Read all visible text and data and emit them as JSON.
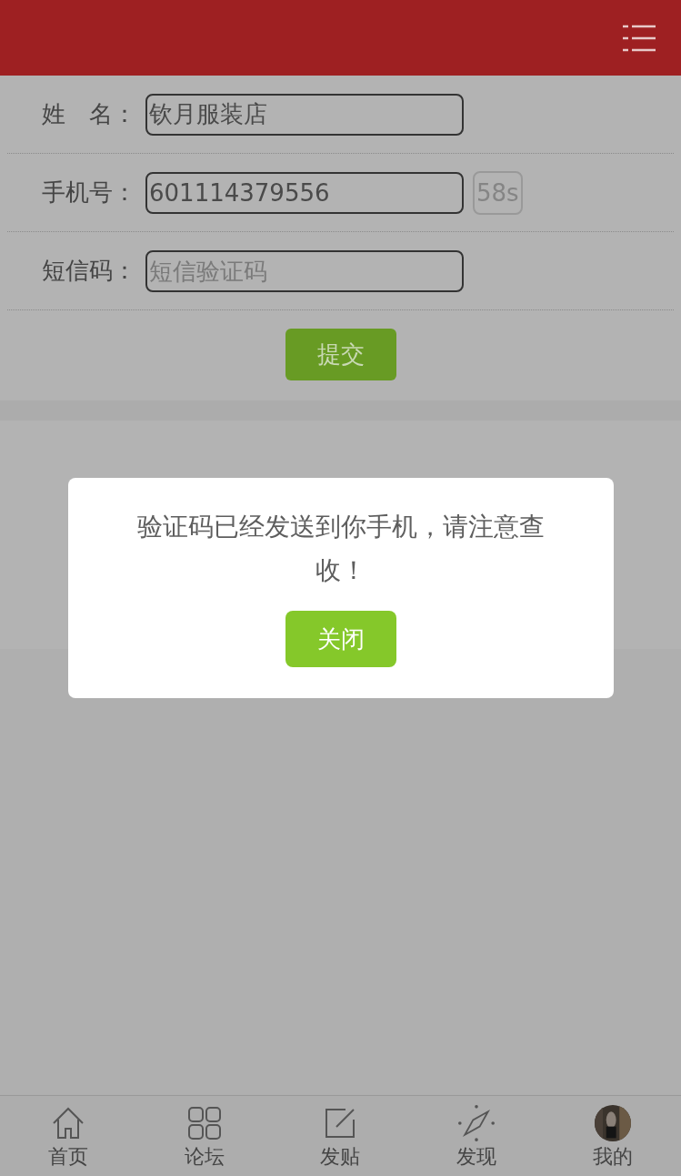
{
  "form": {
    "fields": [
      {
        "label": "姓　名：",
        "value": "钦月服装店"
      },
      {
        "label": "手机号：",
        "value": "601114379556",
        "countdown": "58s"
      },
      {
        "label": "短信码：",
        "placeholder": "短信验证码"
      }
    ],
    "submit": "提交"
  },
  "dialog": {
    "message": "验证码已经发送到你手机，请注意查收！",
    "button": "关闭"
  },
  "tab_bar": [
    {
      "kind": "home",
      "label": "首页"
    },
    {
      "kind": "grid",
      "label": "论坛"
    },
    {
      "kind": "compose",
      "label": "发贴"
    },
    {
      "kind": "compass",
      "label": "发现"
    },
    {
      "kind": "avatar",
      "label": "我的"
    }
  ]
}
